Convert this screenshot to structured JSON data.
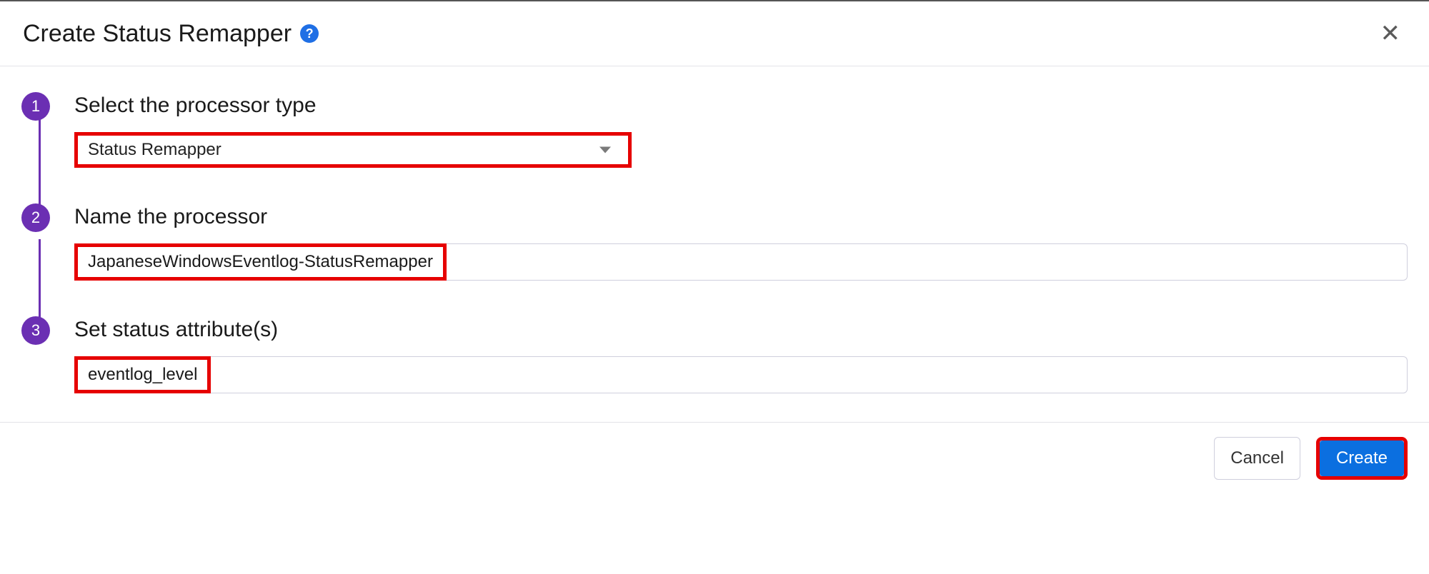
{
  "header": {
    "title": "Create Status Remapper",
    "help_glyph": "?",
    "close_glyph": "✕"
  },
  "steps": [
    {
      "badge": "1",
      "title": "Select the processor type",
      "select_value": "Status Remapper"
    },
    {
      "badge": "2",
      "title": "Name the processor",
      "input_value": "JapaneseWindowsEventlog-StatusRemapper"
    },
    {
      "badge": "3",
      "title": "Set status attribute(s)",
      "input_value": "eventlog_level"
    }
  ],
  "footer": {
    "cancel": "Cancel",
    "create": "Create"
  }
}
